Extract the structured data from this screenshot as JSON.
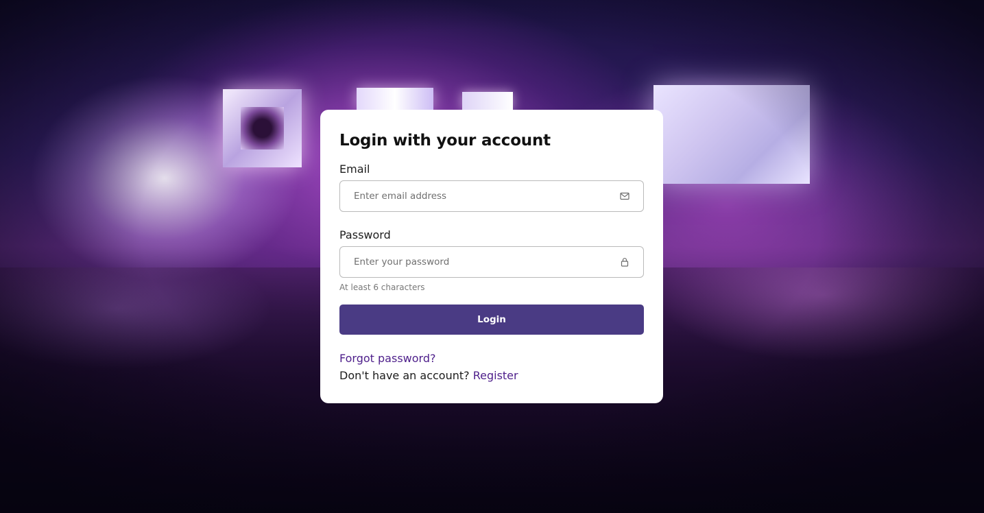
{
  "login_card": {
    "title": "Login with your account",
    "email": {
      "label": "Email",
      "placeholder": "Enter email address",
      "icon": "mail-icon"
    },
    "password": {
      "label": "Password",
      "placeholder": "Enter your password",
      "icon": "lock-icon",
      "hint": "At least 6 characters"
    },
    "submit_label": "Login",
    "forgot_link": "Forgot password?",
    "register_prompt": "Don't have an account?",
    "register_link": "Register"
  },
  "colors": {
    "button": "#4a3b84",
    "link": "#4d1e8a",
    "card": "#ffffff"
  }
}
